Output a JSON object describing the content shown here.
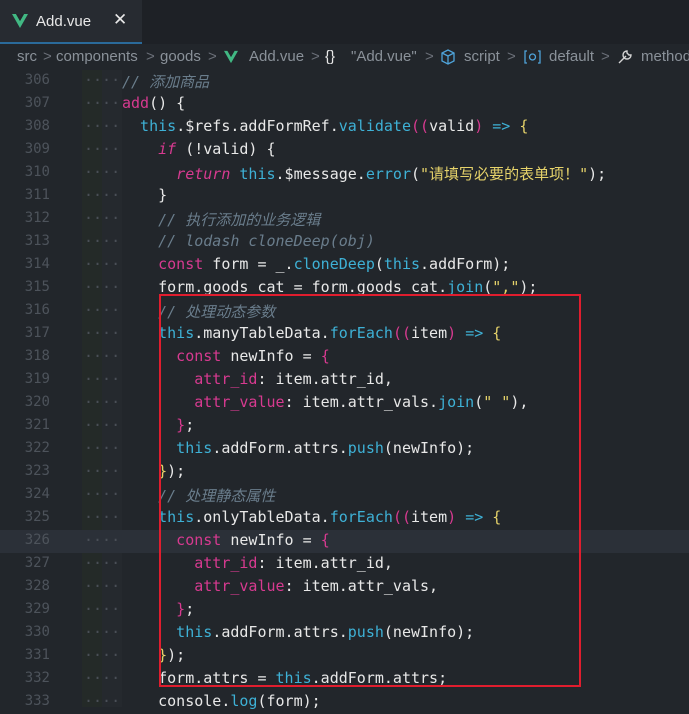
{
  "tab": {
    "title": "Add.vue",
    "close": "✕"
  },
  "breadcrumb": {
    "items": [
      "src",
      "components",
      "goods",
      "Add.vue",
      "\"Add.vue\"",
      "script",
      "default",
      "methods"
    ],
    "separators": [
      ">",
      ">",
      ">",
      ">",
      ">",
      ">",
      ">"
    ]
  },
  "lines": [
    {
      "n": "306",
      "segments": [
        {
          "t": "// 添加商品",
          "c": "c-comment"
        }
      ]
    },
    {
      "n": "307",
      "segments": [
        {
          "t": "add",
          "c": "c-prop"
        },
        {
          "t": "() {",
          "c": "c-plain"
        }
      ]
    },
    {
      "n": "308",
      "segments": [
        {
          "t": "  this",
          "c": "c-this"
        },
        {
          "t": ".$refs.addFormRef.",
          "c": "c-plain"
        },
        {
          "t": "validate",
          "c": "c-fn"
        },
        {
          "t": "((",
          "c": "c-paren"
        },
        {
          "t": "valid",
          "c": "c-plain"
        },
        {
          "t": ") ",
          "c": "c-paren"
        },
        {
          "t": "=>",
          "c": "c-fn"
        },
        {
          "t": " {",
          "c": "c-brace"
        }
      ]
    },
    {
      "n": "309",
      "segments": [
        {
          "t": "    if",
          "c": "c-kw c-italic"
        },
        {
          "t": " (!valid) {",
          "c": "c-plain"
        }
      ]
    },
    {
      "n": "310",
      "segments": [
        {
          "t": "      return",
          "c": "c-kw c-italic"
        },
        {
          "t": " this",
          "c": "c-this"
        },
        {
          "t": ".$message.",
          "c": "c-plain"
        },
        {
          "t": "error",
          "c": "c-fn"
        },
        {
          "t": "(",
          "c": "c-plain"
        },
        {
          "t": "\"请填写必要的表单项！\"",
          "c": "c-str"
        },
        {
          "t": ");",
          "c": "c-plain"
        }
      ]
    },
    {
      "n": "311",
      "segments": [
        {
          "t": "    }",
          "c": "c-plain"
        }
      ]
    },
    {
      "n": "312",
      "segments": [
        {
          "t": "    // 执行添加的业务逻辑",
          "c": "c-comment"
        }
      ]
    },
    {
      "n": "313",
      "segments": [
        {
          "t": "    // lodash cloneDeep(obj)",
          "c": "c-comment"
        }
      ]
    },
    {
      "n": "314",
      "segments": [
        {
          "t": "    const",
          "c": "c-kw"
        },
        {
          "t": " form = _.",
          "c": "c-plain"
        },
        {
          "t": "cloneDeep",
          "c": "c-fn"
        },
        {
          "t": "(",
          "c": "c-plain"
        },
        {
          "t": "this",
          "c": "c-this"
        },
        {
          "t": ".addForm);",
          "c": "c-plain"
        }
      ]
    },
    {
      "n": "315",
      "segments": [
        {
          "t": "    form.goods_cat = form.goods_cat.",
          "c": "c-plain"
        },
        {
          "t": "join",
          "c": "c-fn"
        },
        {
          "t": "(",
          "c": "c-plain"
        },
        {
          "t": "\",\"",
          "c": "c-str"
        },
        {
          "t": ");",
          "c": "c-plain"
        }
      ]
    },
    {
      "n": "316",
      "segments": [
        {
          "t": "    // 处理动态参数",
          "c": "c-comment"
        }
      ]
    },
    {
      "n": "317",
      "segments": [
        {
          "t": "    this",
          "c": "c-this"
        },
        {
          "t": ".manyTableData.",
          "c": "c-plain"
        },
        {
          "t": "forEach",
          "c": "c-fn"
        },
        {
          "t": "((",
          "c": "c-paren"
        },
        {
          "t": "item",
          "c": "c-plain"
        },
        {
          "t": ") ",
          "c": "c-paren"
        },
        {
          "t": "=>",
          "c": "c-fn"
        },
        {
          "t": " {",
          "c": "c-brace"
        }
      ]
    },
    {
      "n": "318",
      "segments": [
        {
          "t": "      const",
          "c": "c-kw"
        },
        {
          "t": " newInfo = ",
          "c": "c-plain"
        },
        {
          "t": "{",
          "c": "c-paren"
        }
      ]
    },
    {
      "n": "319",
      "segments": [
        {
          "t": "        attr_id",
          "c": "c-prop"
        },
        {
          "t": ": item.attr_id,",
          "c": "c-plain"
        }
      ]
    },
    {
      "n": "320",
      "segments": [
        {
          "t": "        attr_value",
          "c": "c-prop"
        },
        {
          "t": ": item.attr_vals.",
          "c": "c-plain"
        },
        {
          "t": "join",
          "c": "c-fn"
        },
        {
          "t": "(",
          "c": "c-plain"
        },
        {
          "t": "\" \"",
          "c": "c-str"
        },
        {
          "t": "),",
          "c": "c-plain"
        }
      ]
    },
    {
      "n": "321",
      "segments": [
        {
          "t": "      }",
          "c": "c-paren"
        },
        {
          "t": ";",
          "c": "c-plain"
        }
      ]
    },
    {
      "n": "322",
      "segments": [
        {
          "t": "      this",
          "c": "c-this"
        },
        {
          "t": ".addForm.attrs.",
          "c": "c-plain"
        },
        {
          "t": "push",
          "c": "c-fn"
        },
        {
          "t": "(newInfo);",
          "c": "c-plain"
        }
      ]
    },
    {
      "n": "323",
      "segments": [
        {
          "t": "    }",
          "c": "c-brace"
        },
        {
          "t": ");",
          "c": "c-plain"
        }
      ]
    },
    {
      "n": "324",
      "segments": [
        {
          "t": "    // 处理静态属性",
          "c": "c-comment"
        }
      ]
    },
    {
      "n": "325",
      "segments": [
        {
          "t": "    this",
          "c": "c-this"
        },
        {
          "t": ".onlyTableData.",
          "c": "c-plain"
        },
        {
          "t": "forEach",
          "c": "c-fn"
        },
        {
          "t": "((",
          "c": "c-paren"
        },
        {
          "t": "item",
          "c": "c-plain"
        },
        {
          "t": ") ",
          "c": "c-paren"
        },
        {
          "t": "=>",
          "c": "c-fn"
        },
        {
          "t": " {",
          "c": "c-brace"
        }
      ]
    },
    {
      "n": "326",
      "segments": [
        {
          "t": "      const",
          "c": "c-kw"
        },
        {
          "t": " newInfo = ",
          "c": "c-plain"
        },
        {
          "t": "{",
          "c": "c-paren"
        }
      ]
    },
    {
      "n": "327",
      "segments": [
        {
          "t": "        attr_id",
          "c": "c-prop"
        },
        {
          "t": ": item.attr_id,",
          "c": "c-plain"
        }
      ]
    },
    {
      "n": "328",
      "segments": [
        {
          "t": "        attr_value",
          "c": "c-prop"
        },
        {
          "t": ": item.attr_vals,",
          "c": "c-plain"
        }
      ]
    },
    {
      "n": "329",
      "segments": [
        {
          "t": "      }",
          "c": "c-paren"
        },
        {
          "t": ";",
          "c": "c-plain"
        }
      ]
    },
    {
      "n": "330",
      "segments": [
        {
          "t": "      this",
          "c": "c-this"
        },
        {
          "t": ".addForm.attrs.",
          "c": "c-plain"
        },
        {
          "t": "push",
          "c": "c-fn"
        },
        {
          "t": "(newInfo);",
          "c": "c-plain"
        }
      ]
    },
    {
      "n": "331",
      "segments": [
        {
          "t": "    }",
          "c": "c-brace"
        },
        {
          "t": ");",
          "c": "c-plain"
        }
      ]
    },
    {
      "n": "332",
      "segments": [
        {
          "t": "    form.attrs = ",
          "c": "c-plain"
        },
        {
          "t": "this",
          "c": "c-this"
        },
        {
          "t": ".addForm.attrs;",
          "c": "c-plain"
        }
      ]
    },
    {
      "n": "333",
      "segments": [
        {
          "t": "    console.",
          "c": "c-plain"
        },
        {
          "t": "log",
          "c": "c-fn"
        },
        {
          "t": "(form);",
          "c": "c-plain"
        }
      ]
    }
  ],
  "current_line": "326",
  "colors": {
    "highlight_box": "#e01d2e",
    "background": "#22262b"
  },
  "icons": [
    "vue-logo-icon",
    "close-icon",
    "braces-icon",
    "cube-icon",
    "symbol-icon",
    "wrench-icon"
  ]
}
